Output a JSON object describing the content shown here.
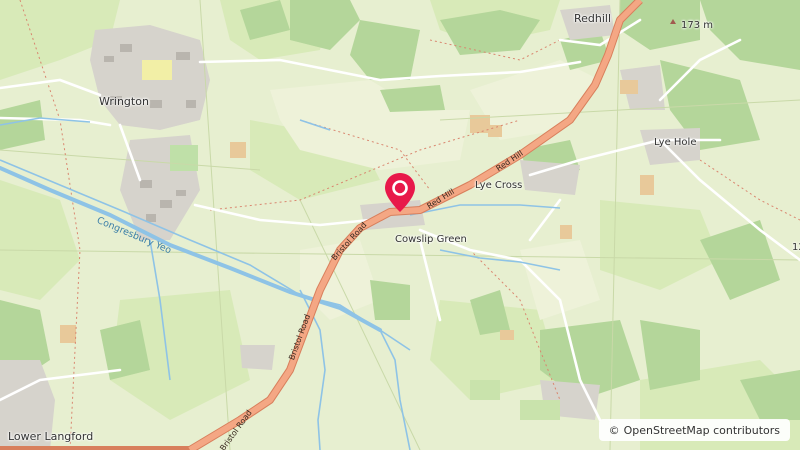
{
  "places": {
    "wrington": "Wrington",
    "redhill": "Redhill",
    "lye_hole": "Lye Hole",
    "lye_cross": "Lye Cross",
    "cowslip_green": "Cowslip Green",
    "lower_langford": "Lower Langford"
  },
  "roads": {
    "red_hill": "Red Hill",
    "bristol_road": "Bristol Road"
  },
  "water": {
    "congresbury_yeo": "Congresbury Yeo"
  },
  "peaks": {
    "summit": "173 m",
    "edge_partial": "12"
  },
  "marker": {
    "icon": "map-pin-icon",
    "color": "#e8194a"
  },
  "attribution": {
    "symbol": "©",
    "text": "OpenStreetMap contributors"
  },
  "colors": {
    "road": "#f0a07c",
    "road_casing": "#d87f5c",
    "water": "#8ec3e6",
    "forest": "#b7d9a1",
    "grass": "#dcecbf",
    "built": "#d9d6cf"
  }
}
